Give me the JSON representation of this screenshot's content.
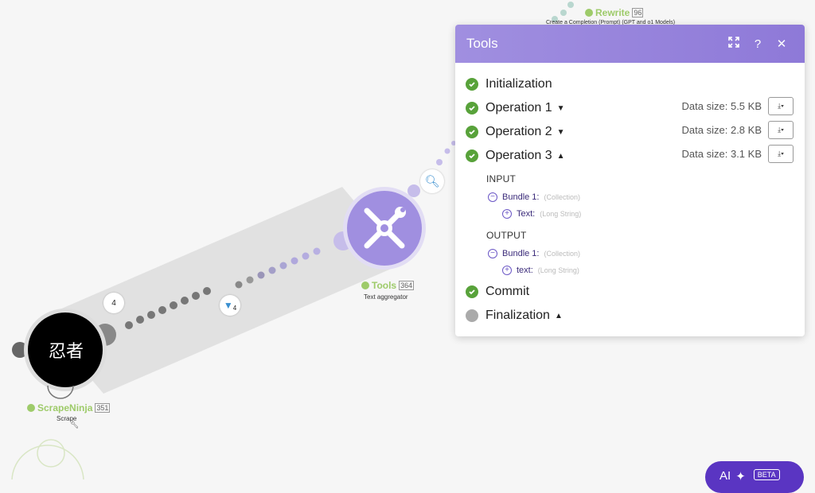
{
  "top_node": {
    "name": "Rewrite",
    "count": "96",
    "sub": "Create a Completion (Prompt) (GPT and o1 Models)"
  },
  "tools_node": {
    "name": "Tools",
    "count": "364",
    "sub": "Text aggregator"
  },
  "scrape_node": {
    "name": "ScrapeNinja",
    "count": "351",
    "sub": "Scrape",
    "logo_text": "忍者"
  },
  "badges": {
    "bundle_count": "4",
    "filter_count": "4"
  },
  "panel": {
    "title": "Tools",
    "icons": [
      "expand-icon",
      "help-icon",
      "close-icon"
    ],
    "help_glyph": "?",
    "close_glyph": "✕",
    "rows": [
      {
        "label": "Initialization",
        "status": "ok"
      },
      {
        "label": "Operation 1",
        "status": "ok",
        "data_size": "Data size: 5.5 KB",
        "expanded": false
      },
      {
        "label": "Operation 2",
        "status": "ok",
        "data_size": "Data size: 2.8 KB",
        "expanded": false
      },
      {
        "label": "Operation 3",
        "status": "ok",
        "data_size": "Data size: 3.1 KB",
        "expanded": true
      }
    ],
    "input_label": "INPUT",
    "output_label": "OUTPUT",
    "input_bundle": {
      "name": "Bundle 1:",
      "type": "(Collection)",
      "child": {
        "name": "Text:",
        "type": "(Long String)"
      }
    },
    "output_bundle": {
      "name": "Bundle 1:",
      "type": "(Collection)",
      "child": {
        "name": "text:",
        "type": "(Long String)"
      }
    },
    "commit": "Commit",
    "finalization": "Finalization"
  },
  "ai_button": {
    "label": "AI",
    "badge": "BETA"
  },
  "colors": {
    "accent": "#8e79d8",
    "ok": "#58a23a",
    "node_purple": "#a08fe0",
    "green_label": "#9ecb6a"
  }
}
